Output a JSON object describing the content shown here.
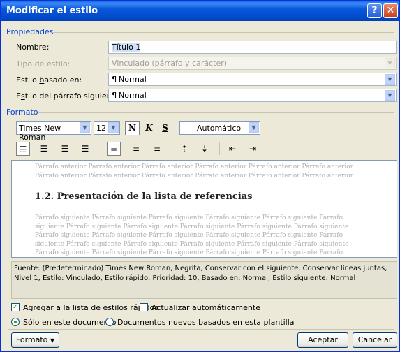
{
  "title": "Modificar el estilo",
  "title_buttons": {
    "help": "?",
    "close": "✕"
  },
  "properties": {
    "section": "Propiedades",
    "name_label": "Nombre:",
    "name_value": "Título 1",
    "type_label": "Tipo de estilo:",
    "type_value": "Vinculado (párrafo y carácter)",
    "based_label": "Estilo basado en:",
    "based_value": "Normal",
    "next_label": "Estilo del párrafo siguiente:",
    "next_value": "Normal"
  },
  "format": {
    "section": "Formato",
    "font": "Times New Roman",
    "size": "12",
    "bold": "N",
    "italic": "K",
    "underline": "S",
    "color": "Automático"
  },
  "preview": {
    "prev_text": "Párrafo anterior Párrafo anterior Párrafo anterior Párrafo anterior Párrafo anterior Párrafo anterior Párrafo anterior Párrafo anterior Párrafo anterior Párrafo anterior Párrafo anterior Párrafo anterior",
    "heading": "1.2. Presentación de la lista de referencias",
    "next_text": "Párrafo siguiente Párrafo siguiente Párrafo siguiente Párrafo siguiente Párrafo siguiente Párrafo siguiente Párrafo siguiente Párrafo siguiente Párrafo siguiente Párrafo siguiente Párrafo siguiente Párrafo siguiente Párrafo siguiente Párrafo siguiente Párrafo siguiente Párrafo siguiente Párrafo siguiente Párrafo siguiente Párrafo siguiente Párrafo siguiente Párrafo siguiente Párrafo siguiente Párrafo siguiente Párrafo siguiente Párrafo siguiente Párrafo siguiente Párrafo siguiente Párrafo siguiente Párrafo siguiente Párrafo siguiente"
  },
  "description": "Fuente: (Predeterminado) Times New Roman, Negrita, Conservar con el siguiente, Conservar líneas juntas, Nivel 1, Estilo: Vinculado, Estilo rápido, Prioridad: 10, Basado en: Normal, Estilo siguiente: Normal",
  "options": {
    "add_quick": "Agregar a la lista de estilos rápidos",
    "auto_update": "Actualizar automáticamente",
    "this_doc": "Sólo en este documento",
    "new_docs": "Documentos nuevos basados en esta plantilla",
    "add_quick_checked": true,
    "auto_update_checked": false
  },
  "buttons": {
    "format": "Formato",
    "ok": "Aceptar",
    "cancel": "Cancelar"
  }
}
